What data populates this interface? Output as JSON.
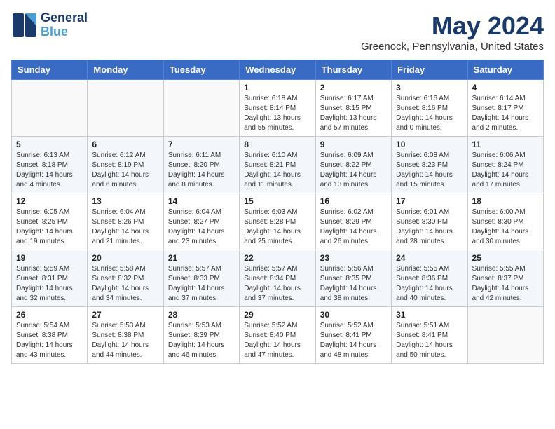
{
  "header": {
    "logo_line1": "General",
    "logo_line2": "Blue",
    "main_title": "May 2024",
    "subtitle": "Greenock, Pennsylvania, United States"
  },
  "weekdays": [
    "Sunday",
    "Monday",
    "Tuesday",
    "Wednesday",
    "Thursday",
    "Friday",
    "Saturday"
  ],
  "weeks": [
    [
      {
        "day": "",
        "info": ""
      },
      {
        "day": "",
        "info": ""
      },
      {
        "day": "",
        "info": ""
      },
      {
        "day": "1",
        "info": "Sunrise: 6:18 AM\nSunset: 8:14 PM\nDaylight: 13 hours\nand 55 minutes."
      },
      {
        "day": "2",
        "info": "Sunrise: 6:17 AM\nSunset: 8:15 PM\nDaylight: 13 hours\nand 57 minutes."
      },
      {
        "day": "3",
        "info": "Sunrise: 6:16 AM\nSunset: 8:16 PM\nDaylight: 14 hours\nand 0 minutes."
      },
      {
        "day": "4",
        "info": "Sunrise: 6:14 AM\nSunset: 8:17 PM\nDaylight: 14 hours\nand 2 minutes."
      }
    ],
    [
      {
        "day": "5",
        "info": "Sunrise: 6:13 AM\nSunset: 8:18 PM\nDaylight: 14 hours\nand 4 minutes."
      },
      {
        "day": "6",
        "info": "Sunrise: 6:12 AM\nSunset: 8:19 PM\nDaylight: 14 hours\nand 6 minutes."
      },
      {
        "day": "7",
        "info": "Sunrise: 6:11 AM\nSunset: 8:20 PM\nDaylight: 14 hours\nand 8 minutes."
      },
      {
        "day": "8",
        "info": "Sunrise: 6:10 AM\nSunset: 8:21 PM\nDaylight: 14 hours\nand 11 minutes."
      },
      {
        "day": "9",
        "info": "Sunrise: 6:09 AM\nSunset: 8:22 PM\nDaylight: 14 hours\nand 13 minutes."
      },
      {
        "day": "10",
        "info": "Sunrise: 6:08 AM\nSunset: 8:23 PM\nDaylight: 14 hours\nand 15 minutes."
      },
      {
        "day": "11",
        "info": "Sunrise: 6:06 AM\nSunset: 8:24 PM\nDaylight: 14 hours\nand 17 minutes."
      }
    ],
    [
      {
        "day": "12",
        "info": "Sunrise: 6:05 AM\nSunset: 8:25 PM\nDaylight: 14 hours\nand 19 minutes."
      },
      {
        "day": "13",
        "info": "Sunrise: 6:04 AM\nSunset: 8:26 PM\nDaylight: 14 hours\nand 21 minutes."
      },
      {
        "day": "14",
        "info": "Sunrise: 6:04 AM\nSunset: 8:27 PM\nDaylight: 14 hours\nand 23 minutes."
      },
      {
        "day": "15",
        "info": "Sunrise: 6:03 AM\nSunset: 8:28 PM\nDaylight: 14 hours\nand 25 minutes."
      },
      {
        "day": "16",
        "info": "Sunrise: 6:02 AM\nSunset: 8:29 PM\nDaylight: 14 hours\nand 26 minutes."
      },
      {
        "day": "17",
        "info": "Sunrise: 6:01 AM\nSunset: 8:30 PM\nDaylight: 14 hours\nand 28 minutes."
      },
      {
        "day": "18",
        "info": "Sunrise: 6:00 AM\nSunset: 8:30 PM\nDaylight: 14 hours\nand 30 minutes."
      }
    ],
    [
      {
        "day": "19",
        "info": "Sunrise: 5:59 AM\nSunset: 8:31 PM\nDaylight: 14 hours\nand 32 minutes."
      },
      {
        "day": "20",
        "info": "Sunrise: 5:58 AM\nSunset: 8:32 PM\nDaylight: 14 hours\nand 34 minutes."
      },
      {
        "day": "21",
        "info": "Sunrise: 5:57 AM\nSunset: 8:33 PM\nDaylight: 14 hours\nand 37 minutes."
      },
      {
        "day": "22",
        "info": "Sunrise: 5:57 AM\nSunset: 8:34 PM\nDaylight: 14 hours\nand 37 minutes."
      },
      {
        "day": "23",
        "info": "Sunrise: 5:56 AM\nSunset: 8:35 PM\nDaylight: 14 hours\nand 38 minutes."
      },
      {
        "day": "24",
        "info": "Sunrise: 5:55 AM\nSunset: 8:36 PM\nDaylight: 14 hours\nand 40 minutes."
      },
      {
        "day": "25",
        "info": "Sunrise: 5:55 AM\nSunset: 8:37 PM\nDaylight: 14 hours\nand 42 minutes."
      }
    ],
    [
      {
        "day": "26",
        "info": "Sunrise: 5:54 AM\nSunset: 8:38 PM\nDaylight: 14 hours\nand 43 minutes."
      },
      {
        "day": "27",
        "info": "Sunrise: 5:53 AM\nSunset: 8:38 PM\nDaylight: 14 hours\nand 44 minutes."
      },
      {
        "day": "28",
        "info": "Sunrise: 5:53 AM\nSunset: 8:39 PM\nDaylight: 14 hours\nand 46 minutes."
      },
      {
        "day": "29",
        "info": "Sunrise: 5:52 AM\nSunset: 8:40 PM\nDaylight: 14 hours\nand 47 minutes."
      },
      {
        "day": "30",
        "info": "Sunrise: 5:52 AM\nSunset: 8:41 PM\nDaylight: 14 hours\nand 48 minutes."
      },
      {
        "day": "31",
        "info": "Sunrise: 5:51 AM\nSunset: 8:41 PM\nDaylight: 14 hours\nand 50 minutes."
      },
      {
        "day": "",
        "info": ""
      }
    ]
  ]
}
